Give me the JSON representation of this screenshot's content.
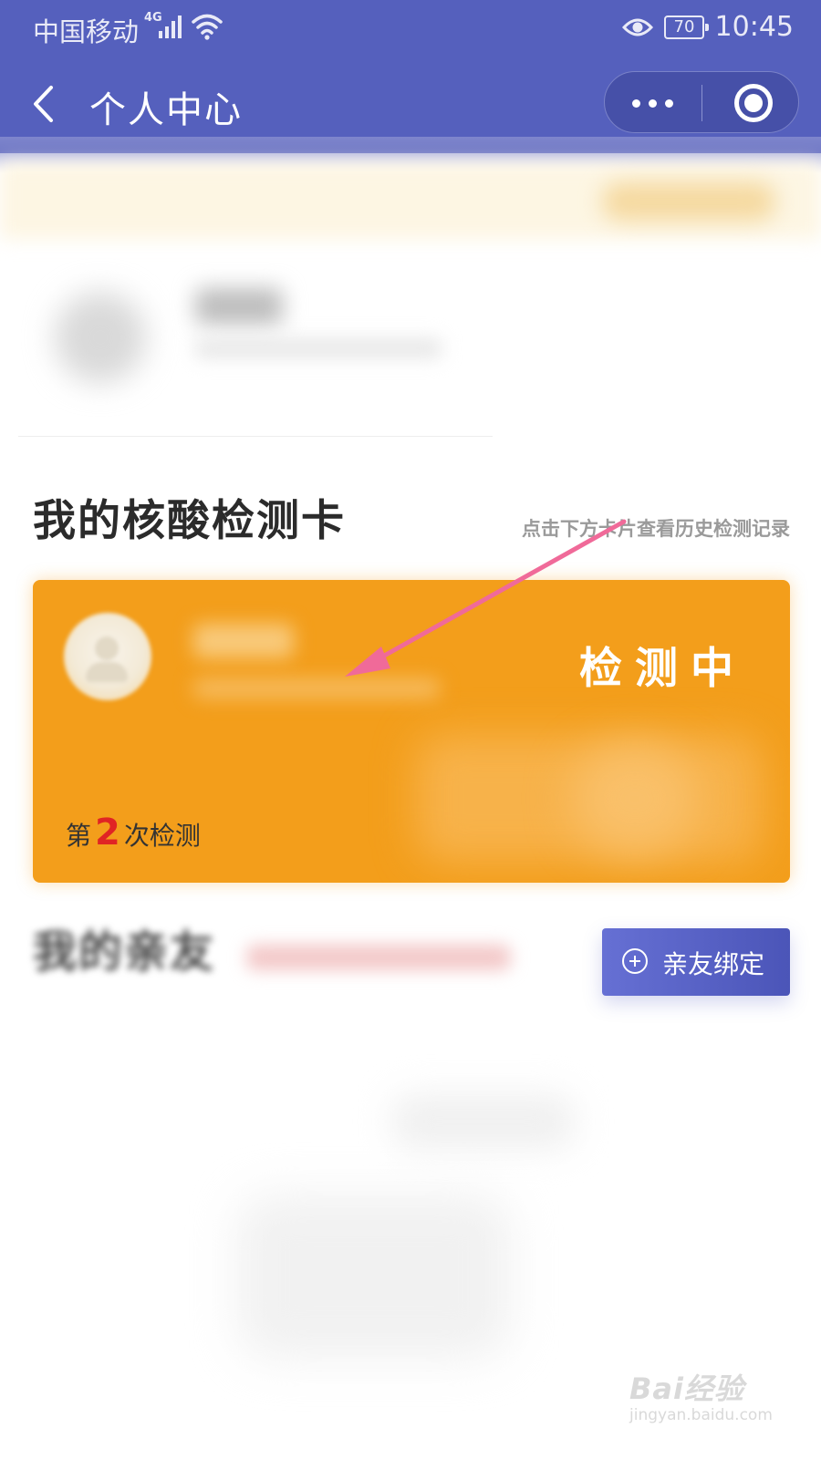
{
  "status_bar": {
    "carrier": "中国移动",
    "network": "4G",
    "battery": "70",
    "time": "10:45"
  },
  "nav": {
    "title": "个人中心",
    "icons": [
      "back-icon",
      "more-icon",
      "close-mini-program-icon"
    ]
  },
  "section": {
    "title": "我的核酸检测卡",
    "hint": "点击下方卡片查看历史检测记录"
  },
  "card": {
    "status": "检测中",
    "count_prefix": "第",
    "count_value": "2",
    "count_suffix": "次检测"
  },
  "friends": {
    "title": "我的亲友",
    "bind_button_label": "亲友绑定"
  },
  "watermark": {
    "main": "Bai经验",
    "url": "jingyan.baidu.com"
  },
  "colors": {
    "header": "#5560bd",
    "card": "#f39e1b",
    "count_number": "#e02424",
    "bind_button": "#5a63c6",
    "annotation_arrow": "#f06a99"
  }
}
